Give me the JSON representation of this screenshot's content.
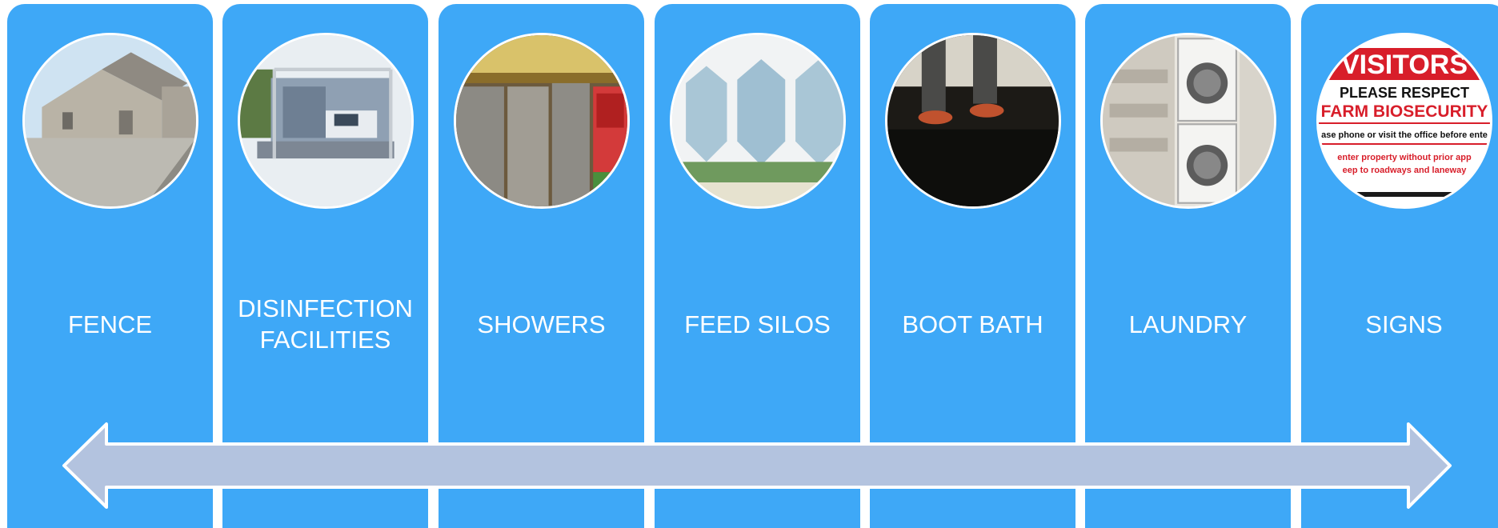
{
  "panels": [
    {
      "label": "FENCE",
      "image": "building-with-fence-photo"
    },
    {
      "label": "DISINFECTION\nFACILITIES",
      "image": "truck-disinfection-photo"
    },
    {
      "label": "SHOWERS",
      "image": "shower-stalls-photo"
    },
    {
      "label": "FEED SILOS",
      "image": "feed-silos-photo"
    },
    {
      "label": "BOOT BATH",
      "image": "boot-bath-photo"
    },
    {
      "label": "LAUNDRY",
      "image": "washer-dryer-photo"
    },
    {
      "label": "SIGNS",
      "image": "biosecurity-sign-photo"
    }
  ],
  "sign": {
    "line1": "VISITORS",
    "line2": "PLEASE RESPECT",
    "line3": "FARM BIOSECURITY",
    "line4": "ase phone or visit the office before ente",
    "line5": "enter property without prior app",
    "line6": "eep to roadways and laneway"
  },
  "colors": {
    "panel": "#3ea8f7",
    "arrow": "#b3c3df",
    "sign_red": "#d81e2a"
  }
}
